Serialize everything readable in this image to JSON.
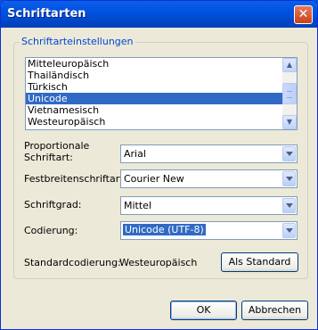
{
  "window": {
    "title": "Schriftarten"
  },
  "group": {
    "label": "Schriftarteinstellungen",
    "list": {
      "items": [
        "Mitteleuropäisch",
        "Thailändisch",
        "Türkisch",
        "Unicode",
        "Vietnamesisch",
        "Westeuropäisch"
      ],
      "selected": "Unicode"
    },
    "proportional": {
      "label": "Proportionale Schriftart:",
      "value": "Arial"
    },
    "fixed": {
      "label": "Festbreitenschriftart:",
      "value": "Courier New"
    },
    "size": {
      "label": "Schriftgrad:",
      "value": "Mittel"
    },
    "encoding": {
      "label": "Codierung:",
      "value": "Unicode (UTF-8)"
    },
    "default_encoding": {
      "label": "Standardcodierung:",
      "value": "Westeuropäisch",
      "button": "Als Standard"
    }
  },
  "buttons": {
    "ok": "OK",
    "cancel": "Abbrechen"
  },
  "icons": {
    "close": "close-icon",
    "scroll_up": "arrow-up-icon",
    "scroll_down": "arrow-down-icon",
    "dropdown": "chevron-down-icon"
  },
  "colors": {
    "titlebar": "#0054e3",
    "selection": "#316ac5",
    "group_label": "#0046d5",
    "dialog_bg": "#ece9d8"
  }
}
